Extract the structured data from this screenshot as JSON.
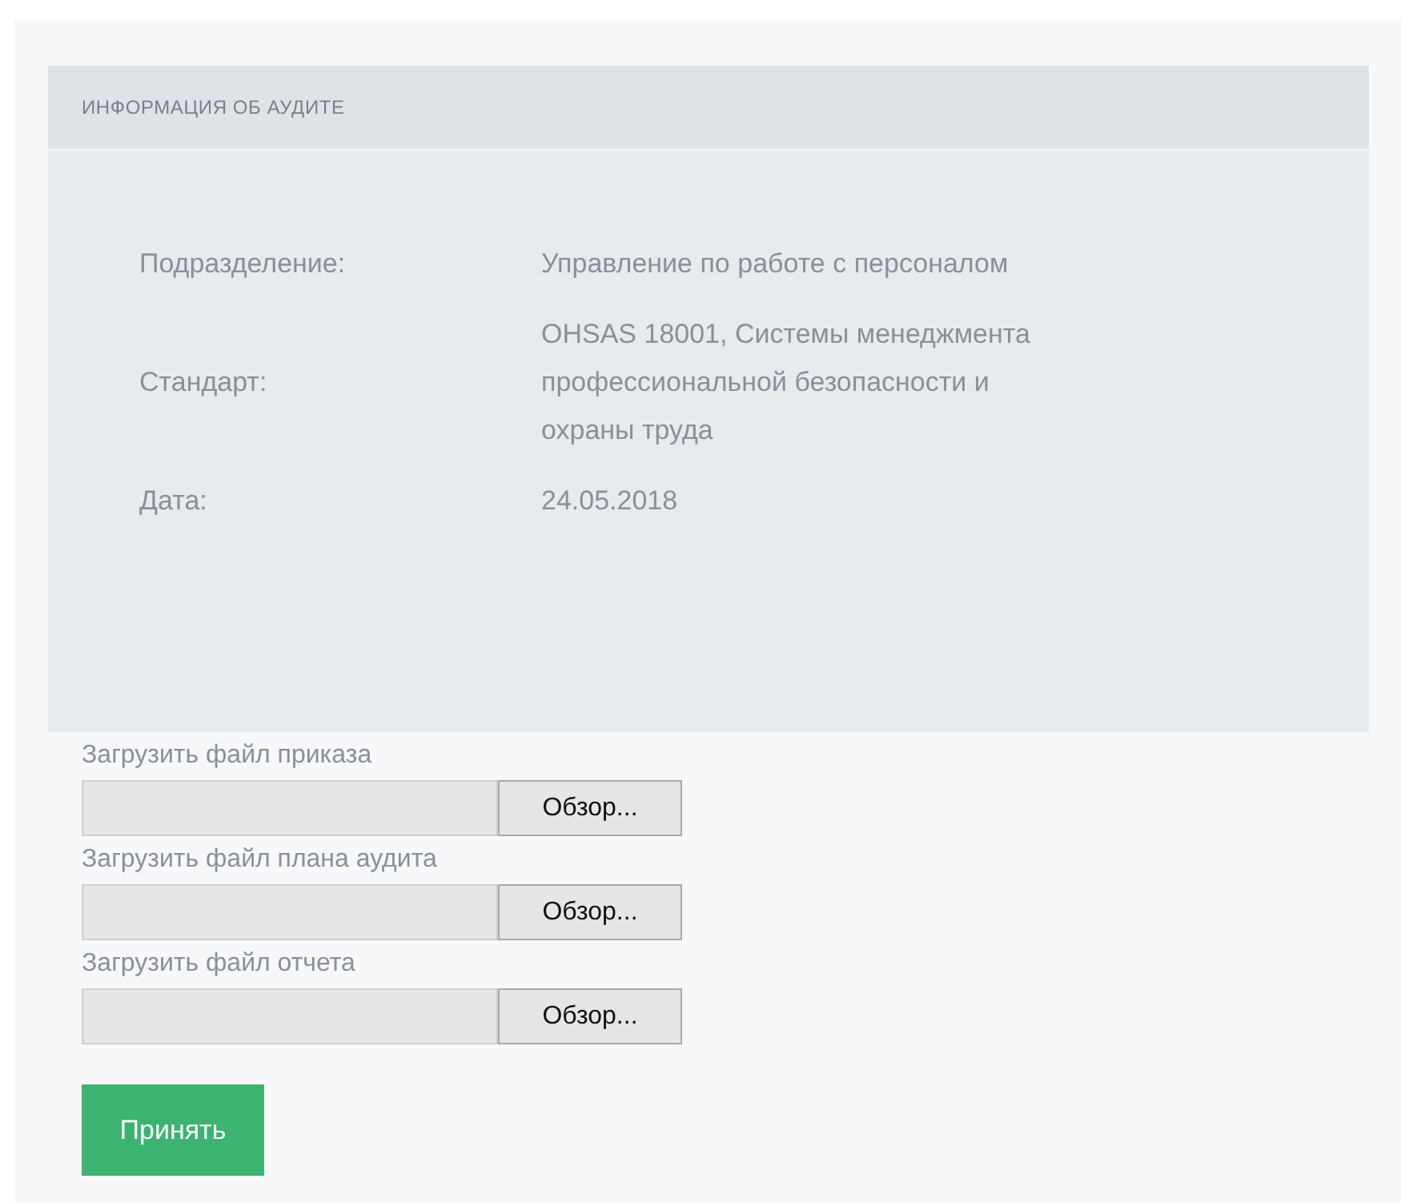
{
  "card": {
    "title": "ИНФОРМАЦИЯ ОБ АУДИТЕ",
    "fields": [
      {
        "label": "Подразделение:",
        "value": "Управление по работе с персоналом"
      },
      {
        "label": "Стандарт:",
        "value": "OHSAS 18001, Системы менеджмента профессиональной безопасности и охраны труда"
      },
      {
        "label": "Дата:",
        "value": "24.05.2018"
      }
    ]
  },
  "uploads": [
    {
      "label": "Загрузить файл приказа",
      "button": "Обзор..."
    },
    {
      "label": "Загрузить файл плана аудита",
      "button": "Обзор..."
    },
    {
      "label": "Загрузить файл отчета",
      "button": "Обзор..."
    }
  ],
  "submit": "Принять"
}
